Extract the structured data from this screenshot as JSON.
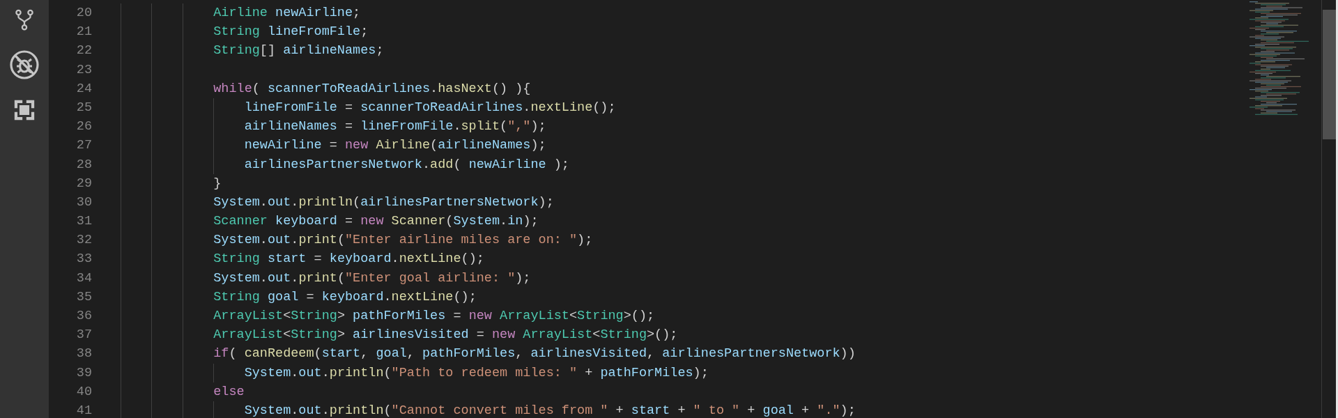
{
  "activity_bar": {
    "items": [
      {
        "kind": "source-control",
        "selected": false
      },
      {
        "kind": "debug",
        "selected": false
      },
      {
        "kind": "extensions",
        "selected": false
      }
    ]
  },
  "editor": {
    "lines": [
      {
        "number": "20",
        "tokens": [
          {
            "kind": "type",
            "text": "            Airline"
          },
          {
            "kind": "var",
            "text": " newAirline"
          },
          {
            "kind": "plain",
            "text": ";"
          }
        ]
      },
      {
        "number": "21",
        "tokens": [
          {
            "kind": "type",
            "text": "            String"
          },
          {
            "kind": "var",
            "text": " lineFromFile"
          },
          {
            "kind": "plain",
            "text": ";"
          }
        ]
      },
      {
        "number": "22",
        "tokens": [
          {
            "kind": "type",
            "text": "            String"
          },
          {
            "kind": "plain",
            "text": "[] "
          },
          {
            "kind": "var",
            "text": "airlineNames"
          },
          {
            "kind": "plain",
            "text": ";"
          }
        ]
      },
      {
        "number": "23"
      },
      {
        "number": "24",
        "tokens": [
          {
            "kind": "keyword",
            "text": "            while"
          },
          {
            "kind": "plain",
            "text": "( "
          },
          {
            "kind": "var",
            "text": "scannerToReadAirlines"
          },
          {
            "kind": "plain",
            "text": "."
          },
          {
            "kind": "func",
            "text": "hasNext"
          },
          {
            "kind": "plain",
            "text": "() ){"
          }
        ]
      },
      {
        "number": "25",
        "tokens": [
          {
            "kind": "var",
            "text": "                lineFromFile"
          },
          {
            "kind": "plain",
            "text": " = "
          },
          {
            "kind": "var",
            "text": "scannerToReadAirlines"
          },
          {
            "kind": "plain",
            "text": "."
          },
          {
            "kind": "func",
            "text": "nextLine"
          },
          {
            "kind": "plain",
            "text": "();"
          }
        ]
      },
      {
        "number": "26",
        "tokens": [
          {
            "kind": "var",
            "text": "                airlineNames"
          },
          {
            "kind": "plain",
            "text": " = "
          },
          {
            "kind": "var",
            "text": "lineFromFile"
          },
          {
            "kind": "plain",
            "text": "."
          },
          {
            "kind": "func",
            "text": "split"
          },
          {
            "kind": "plain",
            "text": "("
          },
          {
            "kind": "string",
            "text": "\",\""
          },
          {
            "kind": "plain",
            "text": ");"
          }
        ]
      },
      {
        "number": "27",
        "tokens": [
          {
            "kind": "var",
            "text": "                newAirline"
          },
          {
            "kind": "plain",
            "text": " = "
          },
          {
            "kind": "keyword",
            "text": "new"
          },
          {
            "kind": "func",
            "text": " Airline"
          },
          {
            "kind": "plain",
            "text": "("
          },
          {
            "kind": "var",
            "text": "airlineNames"
          },
          {
            "kind": "plain",
            "text": ");"
          }
        ]
      },
      {
        "number": "28",
        "tokens": [
          {
            "kind": "var",
            "text": "                airlinesPartnersNetwork"
          },
          {
            "kind": "plain",
            "text": "."
          },
          {
            "kind": "func",
            "text": "add"
          },
          {
            "kind": "plain",
            "text": "( "
          },
          {
            "kind": "var",
            "text": "newAirline"
          },
          {
            "kind": "plain",
            "text": " );"
          }
        ]
      },
      {
        "number": "29",
        "tokens": [
          {
            "kind": "plain",
            "text": "            }"
          }
        ]
      },
      {
        "number": "30",
        "tokens": [
          {
            "kind": "var",
            "text": "            System"
          },
          {
            "kind": "plain",
            "text": "."
          },
          {
            "kind": "var",
            "text": "out"
          },
          {
            "kind": "plain",
            "text": "."
          },
          {
            "kind": "func",
            "text": "println"
          },
          {
            "kind": "plain",
            "text": "("
          },
          {
            "kind": "var",
            "text": "airlinesPartnersNetwork"
          },
          {
            "kind": "plain",
            "text": ");"
          }
        ]
      },
      {
        "number": "31",
        "tokens": [
          {
            "kind": "type",
            "text": "            Scanner"
          },
          {
            "kind": "var",
            "text": " keyboard"
          },
          {
            "kind": "plain",
            "text": " = "
          },
          {
            "kind": "keyword",
            "text": "new"
          },
          {
            "kind": "func",
            "text": " Scanner"
          },
          {
            "kind": "plain",
            "text": "("
          },
          {
            "kind": "var",
            "text": "System"
          },
          {
            "kind": "plain",
            "text": "."
          },
          {
            "kind": "var",
            "text": "in"
          },
          {
            "kind": "plain",
            "text": ");"
          }
        ]
      },
      {
        "number": "32",
        "tokens": [
          {
            "kind": "var",
            "text": "            System"
          },
          {
            "kind": "plain",
            "text": "."
          },
          {
            "kind": "var",
            "text": "out"
          },
          {
            "kind": "plain",
            "text": "."
          },
          {
            "kind": "func",
            "text": "print"
          },
          {
            "kind": "plain",
            "text": "("
          },
          {
            "kind": "string",
            "text": "\"Enter airline miles are on: \""
          },
          {
            "kind": "plain",
            "text": ");"
          }
        ]
      },
      {
        "number": "33",
        "tokens": [
          {
            "kind": "type",
            "text": "            String"
          },
          {
            "kind": "var",
            "text": " start"
          },
          {
            "kind": "plain",
            "text": " = "
          },
          {
            "kind": "var",
            "text": "keyboard"
          },
          {
            "kind": "plain",
            "text": "."
          },
          {
            "kind": "func",
            "text": "nextLine"
          },
          {
            "kind": "plain",
            "text": "();"
          }
        ]
      },
      {
        "number": "34",
        "tokens": [
          {
            "kind": "var",
            "text": "            System"
          },
          {
            "kind": "plain",
            "text": "."
          },
          {
            "kind": "var",
            "text": "out"
          },
          {
            "kind": "plain",
            "text": "."
          },
          {
            "kind": "func",
            "text": "print"
          },
          {
            "kind": "plain",
            "text": "("
          },
          {
            "kind": "string",
            "text": "\"Enter goal airline: \""
          },
          {
            "kind": "plain",
            "text": ");"
          }
        ]
      },
      {
        "number": "35",
        "tokens": [
          {
            "kind": "type",
            "text": "            String"
          },
          {
            "kind": "var",
            "text": " goal"
          },
          {
            "kind": "plain",
            "text": " = "
          },
          {
            "kind": "var",
            "text": "keyboard"
          },
          {
            "kind": "plain",
            "text": "."
          },
          {
            "kind": "func",
            "text": "nextLine"
          },
          {
            "kind": "plain",
            "text": "();"
          }
        ]
      },
      {
        "number": "36",
        "tokens": [
          {
            "kind": "type",
            "text": "            ArrayList"
          },
          {
            "kind": "plain",
            "text": "<"
          },
          {
            "kind": "type",
            "text": "String"
          },
          {
            "kind": "plain",
            "text": "> "
          },
          {
            "kind": "var",
            "text": "pathForMiles"
          },
          {
            "kind": "plain",
            "text": " = "
          },
          {
            "kind": "keyword",
            "text": "new"
          },
          {
            "kind": "type",
            "text": " ArrayList"
          },
          {
            "kind": "plain",
            "text": "<"
          },
          {
            "kind": "type",
            "text": "String"
          },
          {
            "kind": "plain",
            "text": ">();"
          }
        ]
      },
      {
        "number": "37",
        "tokens": [
          {
            "kind": "type",
            "text": "            ArrayList"
          },
          {
            "kind": "plain",
            "text": "<"
          },
          {
            "kind": "type",
            "text": "String"
          },
          {
            "kind": "plain",
            "text": "> "
          },
          {
            "kind": "var",
            "text": "airlinesVisited"
          },
          {
            "kind": "plain",
            "text": " = "
          },
          {
            "kind": "keyword",
            "text": "new"
          },
          {
            "kind": "type",
            "text": " ArrayList"
          },
          {
            "kind": "plain",
            "text": "<"
          },
          {
            "kind": "type",
            "text": "String"
          },
          {
            "kind": "plain",
            "text": ">();"
          }
        ]
      },
      {
        "number": "38",
        "tokens": [
          {
            "kind": "keyword",
            "text": "            if"
          },
          {
            "kind": "plain",
            "text": "( "
          },
          {
            "kind": "func",
            "text": "canRedeem"
          },
          {
            "kind": "plain",
            "text": "("
          },
          {
            "kind": "var",
            "text": "start"
          },
          {
            "kind": "plain",
            "text": ", "
          },
          {
            "kind": "var",
            "text": "goal"
          },
          {
            "kind": "plain",
            "text": ", "
          },
          {
            "kind": "var",
            "text": "pathForMiles"
          },
          {
            "kind": "plain",
            "text": ", "
          },
          {
            "kind": "var",
            "text": "airlinesVisited"
          },
          {
            "kind": "plain",
            "text": ", "
          },
          {
            "kind": "var",
            "text": "airlinesPartnersNetwork"
          },
          {
            "kind": "plain",
            "text": "))"
          }
        ]
      },
      {
        "number": "39",
        "tokens": [
          {
            "kind": "var",
            "text": "                System"
          },
          {
            "kind": "plain",
            "text": "."
          },
          {
            "kind": "var",
            "text": "out"
          },
          {
            "kind": "plain",
            "text": "."
          },
          {
            "kind": "func",
            "text": "println"
          },
          {
            "kind": "plain",
            "text": "("
          },
          {
            "kind": "string",
            "text": "\"Path to redeem miles: \""
          },
          {
            "kind": "plain",
            "text": " + "
          },
          {
            "kind": "var",
            "text": "pathForMiles"
          },
          {
            "kind": "plain",
            "text": ");"
          }
        ]
      },
      {
        "number": "40",
        "tokens": [
          {
            "kind": "keyword",
            "text": "            else"
          }
        ]
      },
      {
        "number": "41",
        "tokens": [
          {
            "kind": "var",
            "text": "                System"
          },
          {
            "kind": "plain",
            "text": "."
          },
          {
            "kind": "var",
            "text": "out"
          },
          {
            "kind": "plain",
            "text": "."
          },
          {
            "kind": "func",
            "text": "println"
          },
          {
            "kind": "plain",
            "text": "("
          },
          {
            "kind": "string",
            "text": "\"Cannot convert miles from \""
          },
          {
            "kind": "plain",
            "text": " + "
          },
          {
            "kind": "var",
            "text": "start"
          },
          {
            "kind": "plain",
            "text": " + "
          },
          {
            "kind": "string",
            "text": "\" to \""
          },
          {
            "kind": "plain",
            "text": " + "
          },
          {
            "kind": "var",
            "text": "goal"
          },
          {
            "kind": "plain",
            "text": " + "
          },
          {
            "kind": "string",
            "text": "\".\""
          },
          {
            "kind": "plain",
            "text": ");"
          }
        ]
      }
    ]
  }
}
